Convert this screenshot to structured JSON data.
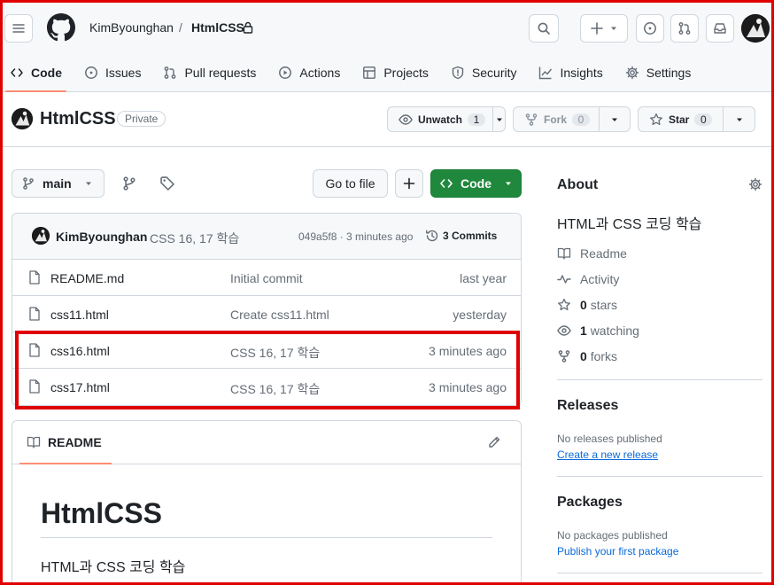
{
  "header": {
    "owner": "KimByounghan",
    "separator": "/",
    "repo": "HtmlCSS"
  },
  "tabs": [
    {
      "label": "Code",
      "icon": "code-icon"
    },
    {
      "label": "Issues",
      "icon": "issue-icon"
    },
    {
      "label": "Pull requests",
      "icon": "pull-request-icon"
    },
    {
      "label": "Actions",
      "icon": "play-icon"
    },
    {
      "label": "Projects",
      "icon": "table-icon"
    },
    {
      "label": "Security",
      "icon": "shield-icon"
    },
    {
      "label": "Insights",
      "icon": "graph-icon"
    },
    {
      "label": "Settings",
      "icon": "gear-icon"
    }
  ],
  "repo": {
    "title": "HtmlCSS",
    "visibility": "Private",
    "watch_label": "Unwatch",
    "watch_count": "1",
    "fork_label": "Fork",
    "fork_count": "0",
    "star_label": "Star",
    "star_count": "0"
  },
  "toolbar": {
    "branch": "main",
    "go_to_file": "Go to file",
    "code_label": "Code"
  },
  "latest_commit": {
    "author": "KimByounghan",
    "message": "CSS 16, 17 학습",
    "meta": "049a5f8 · 3 minutes ago",
    "commits_label": "3 Commits"
  },
  "files": [
    {
      "name": "README.md",
      "message": "Initial commit",
      "time": "last year"
    },
    {
      "name": "css11.html",
      "message": "Create css11.html",
      "time": "yesterday"
    },
    {
      "name": "css16.html",
      "message": "CSS 16, 17 학습",
      "time": "3 minutes ago"
    },
    {
      "name": "css17.html",
      "message": "CSS 16, 17 학습",
      "time": "3 minutes ago"
    }
  ],
  "readme": {
    "tab_label": "README",
    "heading": "HtmlCSS",
    "text": "HTML과 CSS 코딩 학습"
  },
  "about": {
    "title": "About",
    "description": "HTML과 CSS 코딩 학습",
    "readme": "Readme",
    "activity": "Activity",
    "stars_count": "0",
    "stars_label": "stars",
    "watching_count": "1",
    "watching_label": "watching",
    "forks_count": "0",
    "forks_label": "forks"
  },
  "releases": {
    "title": "Releases",
    "empty": "No releases published",
    "link": "Create a new release"
  },
  "packages": {
    "title": "Packages",
    "empty": "No packages published",
    "link": "Publish your first package"
  },
  "colors": {
    "accent_green": "#1f883d",
    "tab_underline": "#fd8c73",
    "highlight_red": "#e00000",
    "link_blue": "#0969da"
  }
}
